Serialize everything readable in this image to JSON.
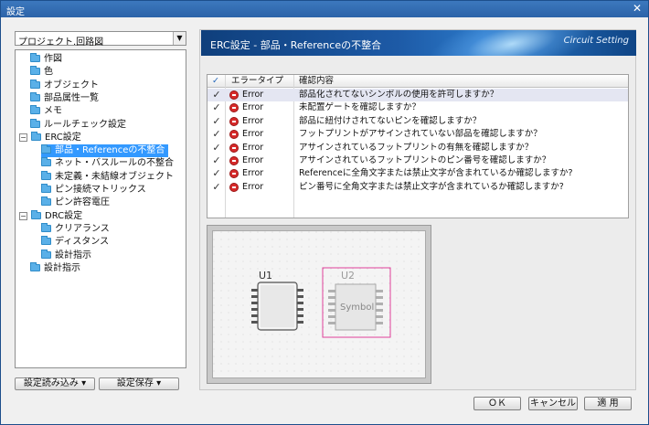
{
  "window": {
    "title": "設定",
    "close_glyph": "✕"
  },
  "left": {
    "combo_value": "プロジェクト.回路図",
    "tree": [
      {
        "label": "作図",
        "level": 1
      },
      {
        "label": "色",
        "level": 1
      },
      {
        "label": "オブジェクト",
        "level": 1
      },
      {
        "label": "部品属性一覧",
        "level": 1
      },
      {
        "label": "メモ",
        "level": 1
      },
      {
        "label": "ルールチェック設定",
        "level": 1
      },
      {
        "label": "ERC設定",
        "level": 0,
        "expander": "−"
      },
      {
        "label": "部品・Referenceの不整合",
        "level": 2,
        "selected": true
      },
      {
        "label": "ネット・バスルールの不整合",
        "level": 2
      },
      {
        "label": "未定義・未結線オブジェクト",
        "level": 2
      },
      {
        "label": "ピン接続マトリックス",
        "level": 2
      },
      {
        "label": "ピン許容電圧",
        "level": 2
      },
      {
        "label": "DRC設定",
        "level": 0,
        "expander": "−"
      },
      {
        "label": "クリアランス",
        "level": 2
      },
      {
        "label": "ディスタンス",
        "level": 2
      },
      {
        "label": "設計指示",
        "level": 2
      },
      {
        "label": "設計指示",
        "level": 1
      }
    ],
    "load_button": "設定読み込み ▾",
    "save_button": "設定保存 ▾"
  },
  "banner": {
    "title": "ERC設定 - 部品・Referenceの不整合",
    "brand": "Circuit Setting"
  },
  "grid": {
    "headers": {
      "check": "✓",
      "type": "エラータイプ",
      "content": "確認内容"
    },
    "rows": [
      {
        "checked": true,
        "type": "Error",
        "content": "部品化されてないシンボルの使用を許可しますか？",
        "selected": true
      },
      {
        "checked": true,
        "type": "Error",
        "content": "未配置ゲートを確認しますか？"
      },
      {
        "checked": true,
        "type": "Error",
        "content": "部品に紐付けされてないピンを確認しますか？"
      },
      {
        "checked": true,
        "type": "Error",
        "content": "フットプリントがアサインされていない部品を確認しますか？"
      },
      {
        "checked": true,
        "type": "Error",
        "content": "アサインされているフットプリントの有無を確認しますか？"
      },
      {
        "checked": true,
        "type": "Error",
        "content": "アサインされているフットプリントのピン番号を確認しますか？"
      },
      {
        "checked": true,
        "type": "Error",
        "content": "Referenceに全角文字または禁止文字が含まれているか確認しますか?"
      },
      {
        "checked": true,
        "type": "Error",
        "content": "ピン番号に全角文字または禁止文字が含まれているか確認しますか?"
      }
    ]
  },
  "preview": {
    "u1": "U1",
    "u2": "U2",
    "symbol": "Symbol",
    "highlight_color": "#e0409a"
  },
  "buttons": {
    "ok": "ＯＫ",
    "cancel": "キャンセル",
    "apply": "適 用"
  }
}
